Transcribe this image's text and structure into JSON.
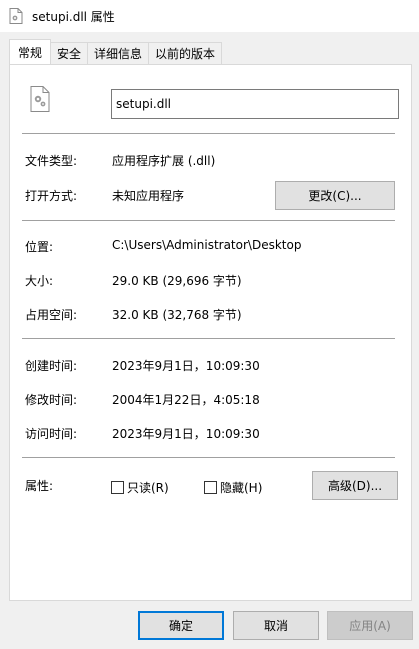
{
  "window": {
    "title": "setupi.dll 属性"
  },
  "tabs": [
    {
      "label": "常规"
    },
    {
      "label": "安全"
    },
    {
      "label": "详细信息"
    },
    {
      "label": "以前的版本"
    }
  ],
  "file": {
    "name": "setupi.dll"
  },
  "type": {
    "label": "文件类型:",
    "value": "应用程序扩展 (.dll)"
  },
  "open_with": {
    "label": "打开方式:",
    "value": "未知应用程序",
    "change_button": "更改(C)..."
  },
  "location": {
    "label": "位置:",
    "value": "C:\\Users\\Administrator\\Desktop"
  },
  "size": {
    "label": "大小:",
    "value": "29.0 KB (29,696 字节)"
  },
  "size_on_disk": {
    "label": "占用空间:",
    "value": "32.0 KB (32,768 字节)"
  },
  "created": {
    "label": "创建时间:",
    "value": "2023年9月1日，10:09:30"
  },
  "modified": {
    "label": "修改时间:",
    "value": "2004年1月22日，4:05:18"
  },
  "accessed": {
    "label": "访问时间:",
    "value": "2023年9月1日，10:09:30"
  },
  "attributes": {
    "label": "属性:",
    "readonly": "只读(R)",
    "hidden": "隐藏(H)",
    "advanced_button": "高级(D)..."
  },
  "footer": {
    "ok": "确定",
    "cancel": "取消",
    "apply": "应用(A)"
  },
  "colors": {
    "focus_border": "#0078d7",
    "panel": "#ffffff",
    "dialog": "#f0f0f0"
  },
  "icons": {
    "title": "dll-gear-icon",
    "file": "dll-gear-icon"
  }
}
